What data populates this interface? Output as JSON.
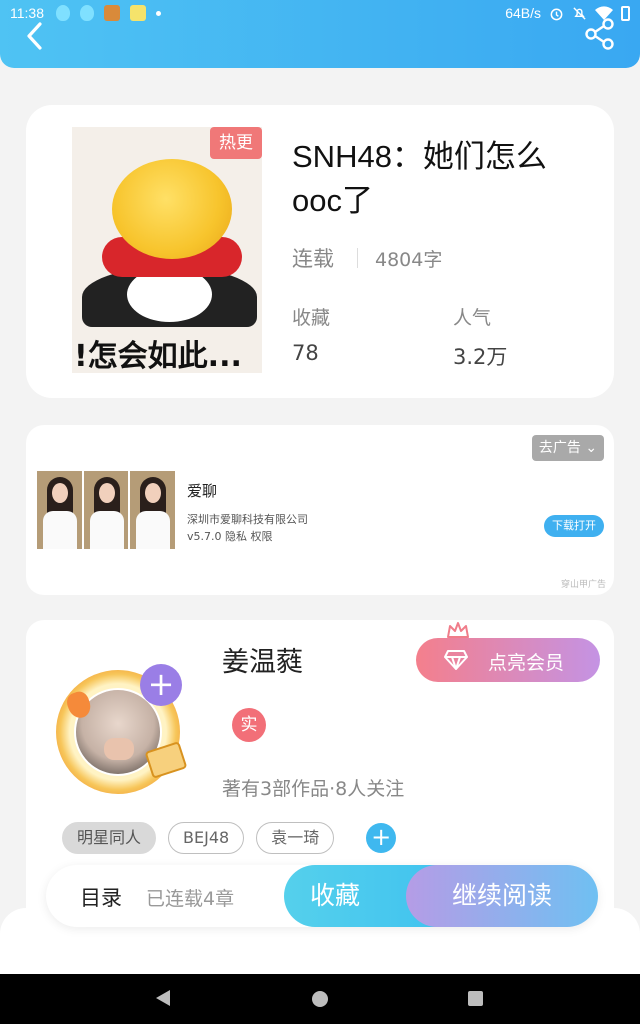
{
  "status_bar": {
    "time": "11:38",
    "speed": "64B/s"
  },
  "book": {
    "hot_badge": "热更",
    "title": "SNH48：她们怎么ooc了",
    "cover_caption": "!怎会如此...",
    "status": "连载",
    "word_count": "4804字",
    "favorites_label": "收藏",
    "favorites_value": "78",
    "popularity_label": "人气",
    "popularity_value": "3.2万"
  },
  "ad": {
    "remove_label": "去广告",
    "app_name": "爱聊",
    "company": "深圳市爱聊科技有限公司",
    "version_line": "v5.7.0  隐私  权限",
    "download_label": "下载打开",
    "source": "穿山甲广告"
  },
  "author": {
    "name": "姜温蕤",
    "vip_label": "点亮会员",
    "real_badge": "实",
    "stats": "著有3部作品·8人关注",
    "tags": [
      "明星同人",
      "BEJ48",
      "袁一琦"
    ],
    "add_icon": "+"
  },
  "action_bar": {
    "toc_label": "目录",
    "chapters": "已连载4章",
    "favorite_button": "收藏",
    "continue_button": "继续阅读"
  },
  "icons": {
    "back": "chevron-left-icon",
    "share": "share-icon"
  },
  "colors": {
    "header": "#3fb2f3",
    "hot_badge": "#f07878",
    "accent_blue": "#3cc0f0",
    "vip_gradient_start": "#f47f8c",
    "vip_gradient_end": "#c493e4"
  }
}
